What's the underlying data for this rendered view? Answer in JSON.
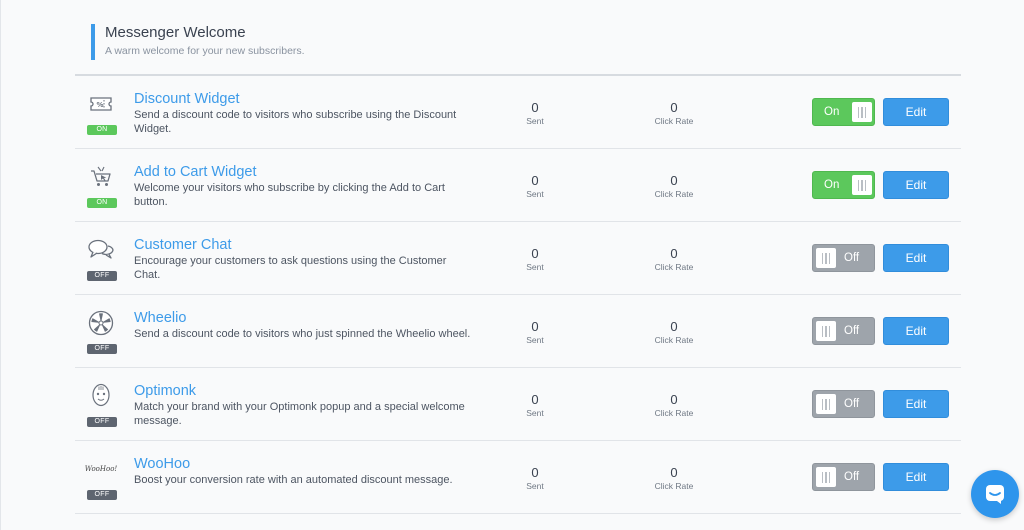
{
  "header": {
    "title": "Messenger Welcome",
    "subtitle": "A warm welcome for your new subscribers."
  },
  "labels": {
    "sent": "Sent",
    "click_rate": "Click Rate",
    "edit": "Edit",
    "on": "On",
    "off": "Off",
    "badge_on": "ON",
    "badge_off": "OFF"
  },
  "items": [
    {
      "name": "Discount Widget",
      "desc": "Send a discount code to visitors who subscribe using the Discount Widget.",
      "sent": "0",
      "click_rate": "0",
      "enabled": true,
      "icon": "discount-tag-icon"
    },
    {
      "name": "Add to Cart Widget",
      "desc": "Welcome your visitors who subscribe by clicking the Add to Cart button.",
      "sent": "0",
      "click_rate": "0",
      "enabled": true,
      "icon": "shopping-cart-icon"
    },
    {
      "name": "Customer Chat",
      "desc": "Encourage your customers to ask questions using the Customer Chat.",
      "sent": "0",
      "click_rate": "0",
      "enabled": false,
      "icon": "chat-bubbles-icon"
    },
    {
      "name": "Wheelio",
      "desc": "Send a discount code to visitors who just spinned the Wheelio wheel.",
      "sent": "0",
      "click_rate": "0",
      "enabled": false,
      "icon": "wheel-icon"
    },
    {
      "name": "Optimonk",
      "desc": "Match your brand with your Optimonk popup and a special welcome message.",
      "sent": "0",
      "click_rate": "0",
      "enabled": false,
      "icon": "optimonk-face-icon"
    },
    {
      "name": "WooHoo",
      "desc": "Boost your conversion rate with an automated discount message.",
      "sent": "0",
      "click_rate": "0",
      "enabled": false,
      "icon": "woohoo-logo-icon",
      "logo_text": "WooHoo!"
    }
  ],
  "colors": {
    "accent": "#3d9be9",
    "on": "#5cc85c",
    "off": "#9ea4ab"
  }
}
